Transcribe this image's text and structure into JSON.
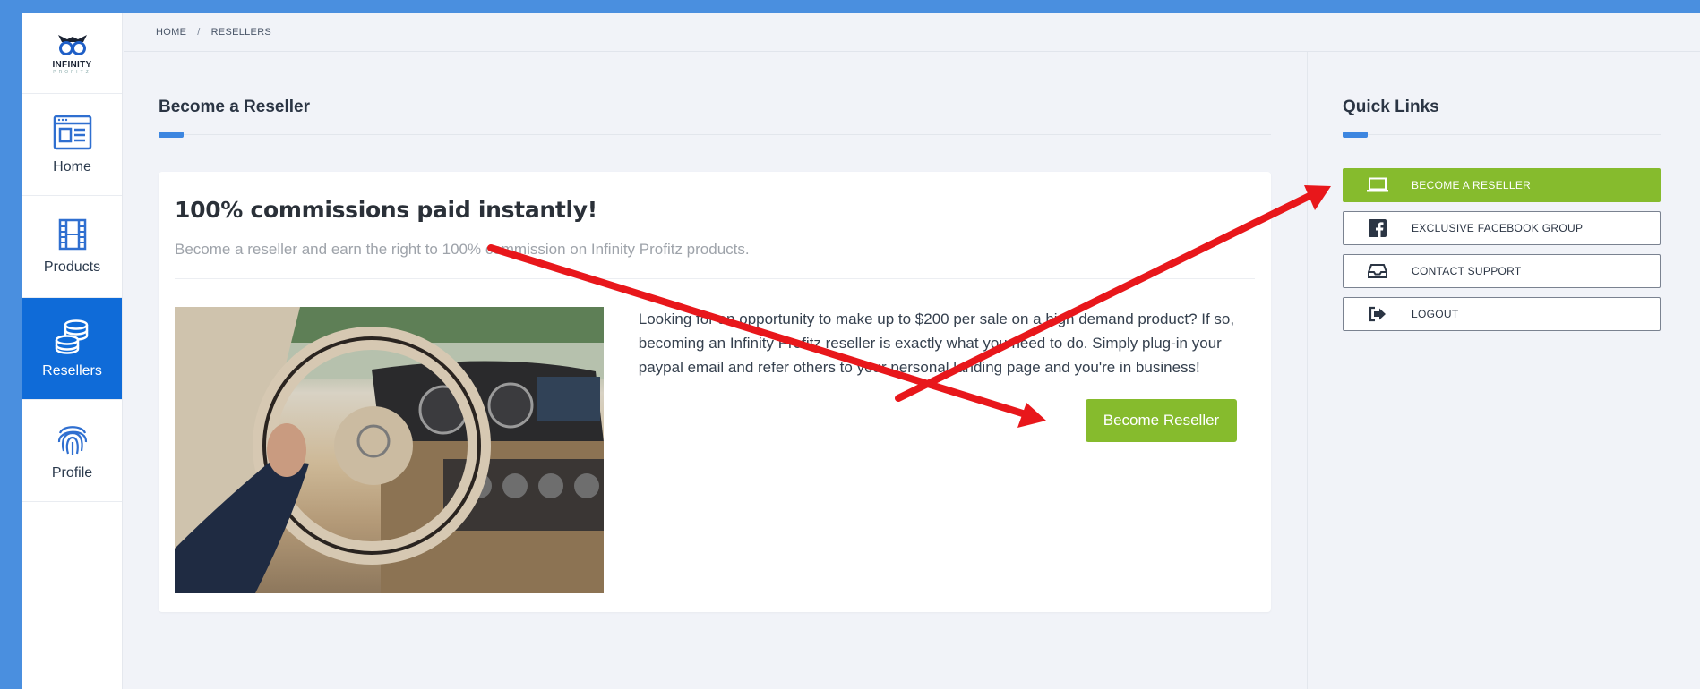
{
  "brand": {
    "logo_main": "INFINITY",
    "logo_sub": "PROFITZ"
  },
  "sidebar": {
    "items": [
      {
        "label": "Home",
        "icon": "browser-window-icon",
        "active": false
      },
      {
        "label": "Products",
        "icon": "film-strip-icon",
        "active": false
      },
      {
        "label": "Resellers",
        "icon": "coin-stack-icon",
        "active": true
      },
      {
        "label": "Profile",
        "icon": "fingerprint-icon",
        "active": false
      }
    ]
  },
  "breadcrumb": {
    "home": "HOME",
    "separator": "/",
    "current": "RESELLERS"
  },
  "main": {
    "section_title": "Become a Reseller",
    "card": {
      "heading": "100% commissions paid instantly!",
      "subtitle": "Become a reseller and earn the right to 100% commission on Infinity Profitz products.",
      "body": "Looking for an opportunity to make up to $200 per sale on a high demand product? If so, becoming an Infinity Profitz reseller is exactly what you need to do. Simply plug-in your paypal email and refer others to your personal landing page and you're in business!",
      "button_label": "Become Reseller"
    }
  },
  "quick_links": {
    "title": "Quick Links",
    "items": [
      {
        "label": "BECOME A RESELLER",
        "icon": "laptop-icon",
        "style": "primary"
      },
      {
        "label": "EXCLUSIVE FACEBOOK GROUP",
        "icon": "facebook-icon",
        "style": "outline"
      },
      {
        "label": "CONTACT SUPPORT",
        "icon": "inbox-icon",
        "style": "outline"
      },
      {
        "label": "LOGOUT",
        "icon": "logout-icon",
        "style": "outline"
      }
    ]
  },
  "colors": {
    "accent_blue": "#0f6bd8",
    "accent_green": "#86bb2d",
    "annotation_red": "#e8171b"
  }
}
